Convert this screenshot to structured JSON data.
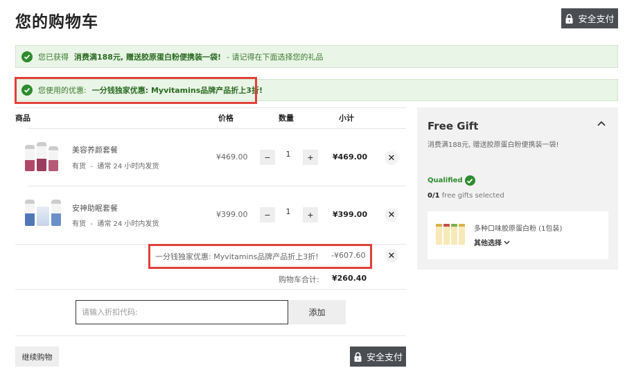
{
  "header": {
    "title": "您的购物车",
    "secure_checkout_label": "安全支付"
  },
  "banners": {
    "offer_prefix": "您已获得",
    "offer_highlight": "消费满188元, 赠送胶原蛋白粉便携装一袋!",
    "offer_suffix": "- 请记得在下面选择您的礼品",
    "coupon_prefix": "您使用的优惠:",
    "coupon_highlight": "一分钱独家优惠: Myvitamins品牌产品折上3折!"
  },
  "table": {
    "headers": {
      "product": "商品",
      "price": "价格",
      "quantity": "数量",
      "subtotal": "小计"
    },
    "items": [
      {
        "name": "美容养颜套餐",
        "stock": "有货",
        "shipping": "通常 24 小时内发货",
        "price": "¥469.00",
        "qty": "1",
        "subtotal": "¥469.00"
      },
      {
        "name": "安神助眠套餐",
        "stock": "有货",
        "shipping": "通常 24 小时内发货",
        "price": "¥399.00",
        "qty": "1",
        "subtotal": "¥399.00"
      }
    ],
    "qty_minus": "−",
    "qty_plus": "+",
    "remove": "✕"
  },
  "discount": {
    "label": "一分钱独家优惠: Myvitamins品牌产品折上3折!",
    "value": "-¥607.60"
  },
  "total": {
    "label": "购物车合计:",
    "value": "¥260.40"
  },
  "coupon": {
    "placeholder": "请输入折扣代码:",
    "add_label": "添加"
  },
  "footer": {
    "continue_label": "继续购物",
    "secure_checkout_label": "安全支付"
  },
  "gift": {
    "title": "Free Gift",
    "description": "消费满188元, 赠送胶原蛋白粉便携装一袋!",
    "qualified_label": "Qualified",
    "count_selected": "0",
    "count_total": "/1",
    "count_suffix": "free gifts selected",
    "item_name": "多种口味胶原蛋白粉 (1包装)",
    "other_options": "其他选择"
  },
  "colors": {
    "accent_green": "#2e8b2e",
    "banner_bg": "#e9f5e6",
    "highlight_red": "#e0403a",
    "button_dark": "#4a4d52"
  },
  "icons": {
    "lock": "lock-icon",
    "check": "check-circle-icon",
    "close": "close-icon",
    "chevron_up": "chevron-up-icon",
    "chevron_down": "chevron-down-icon"
  }
}
